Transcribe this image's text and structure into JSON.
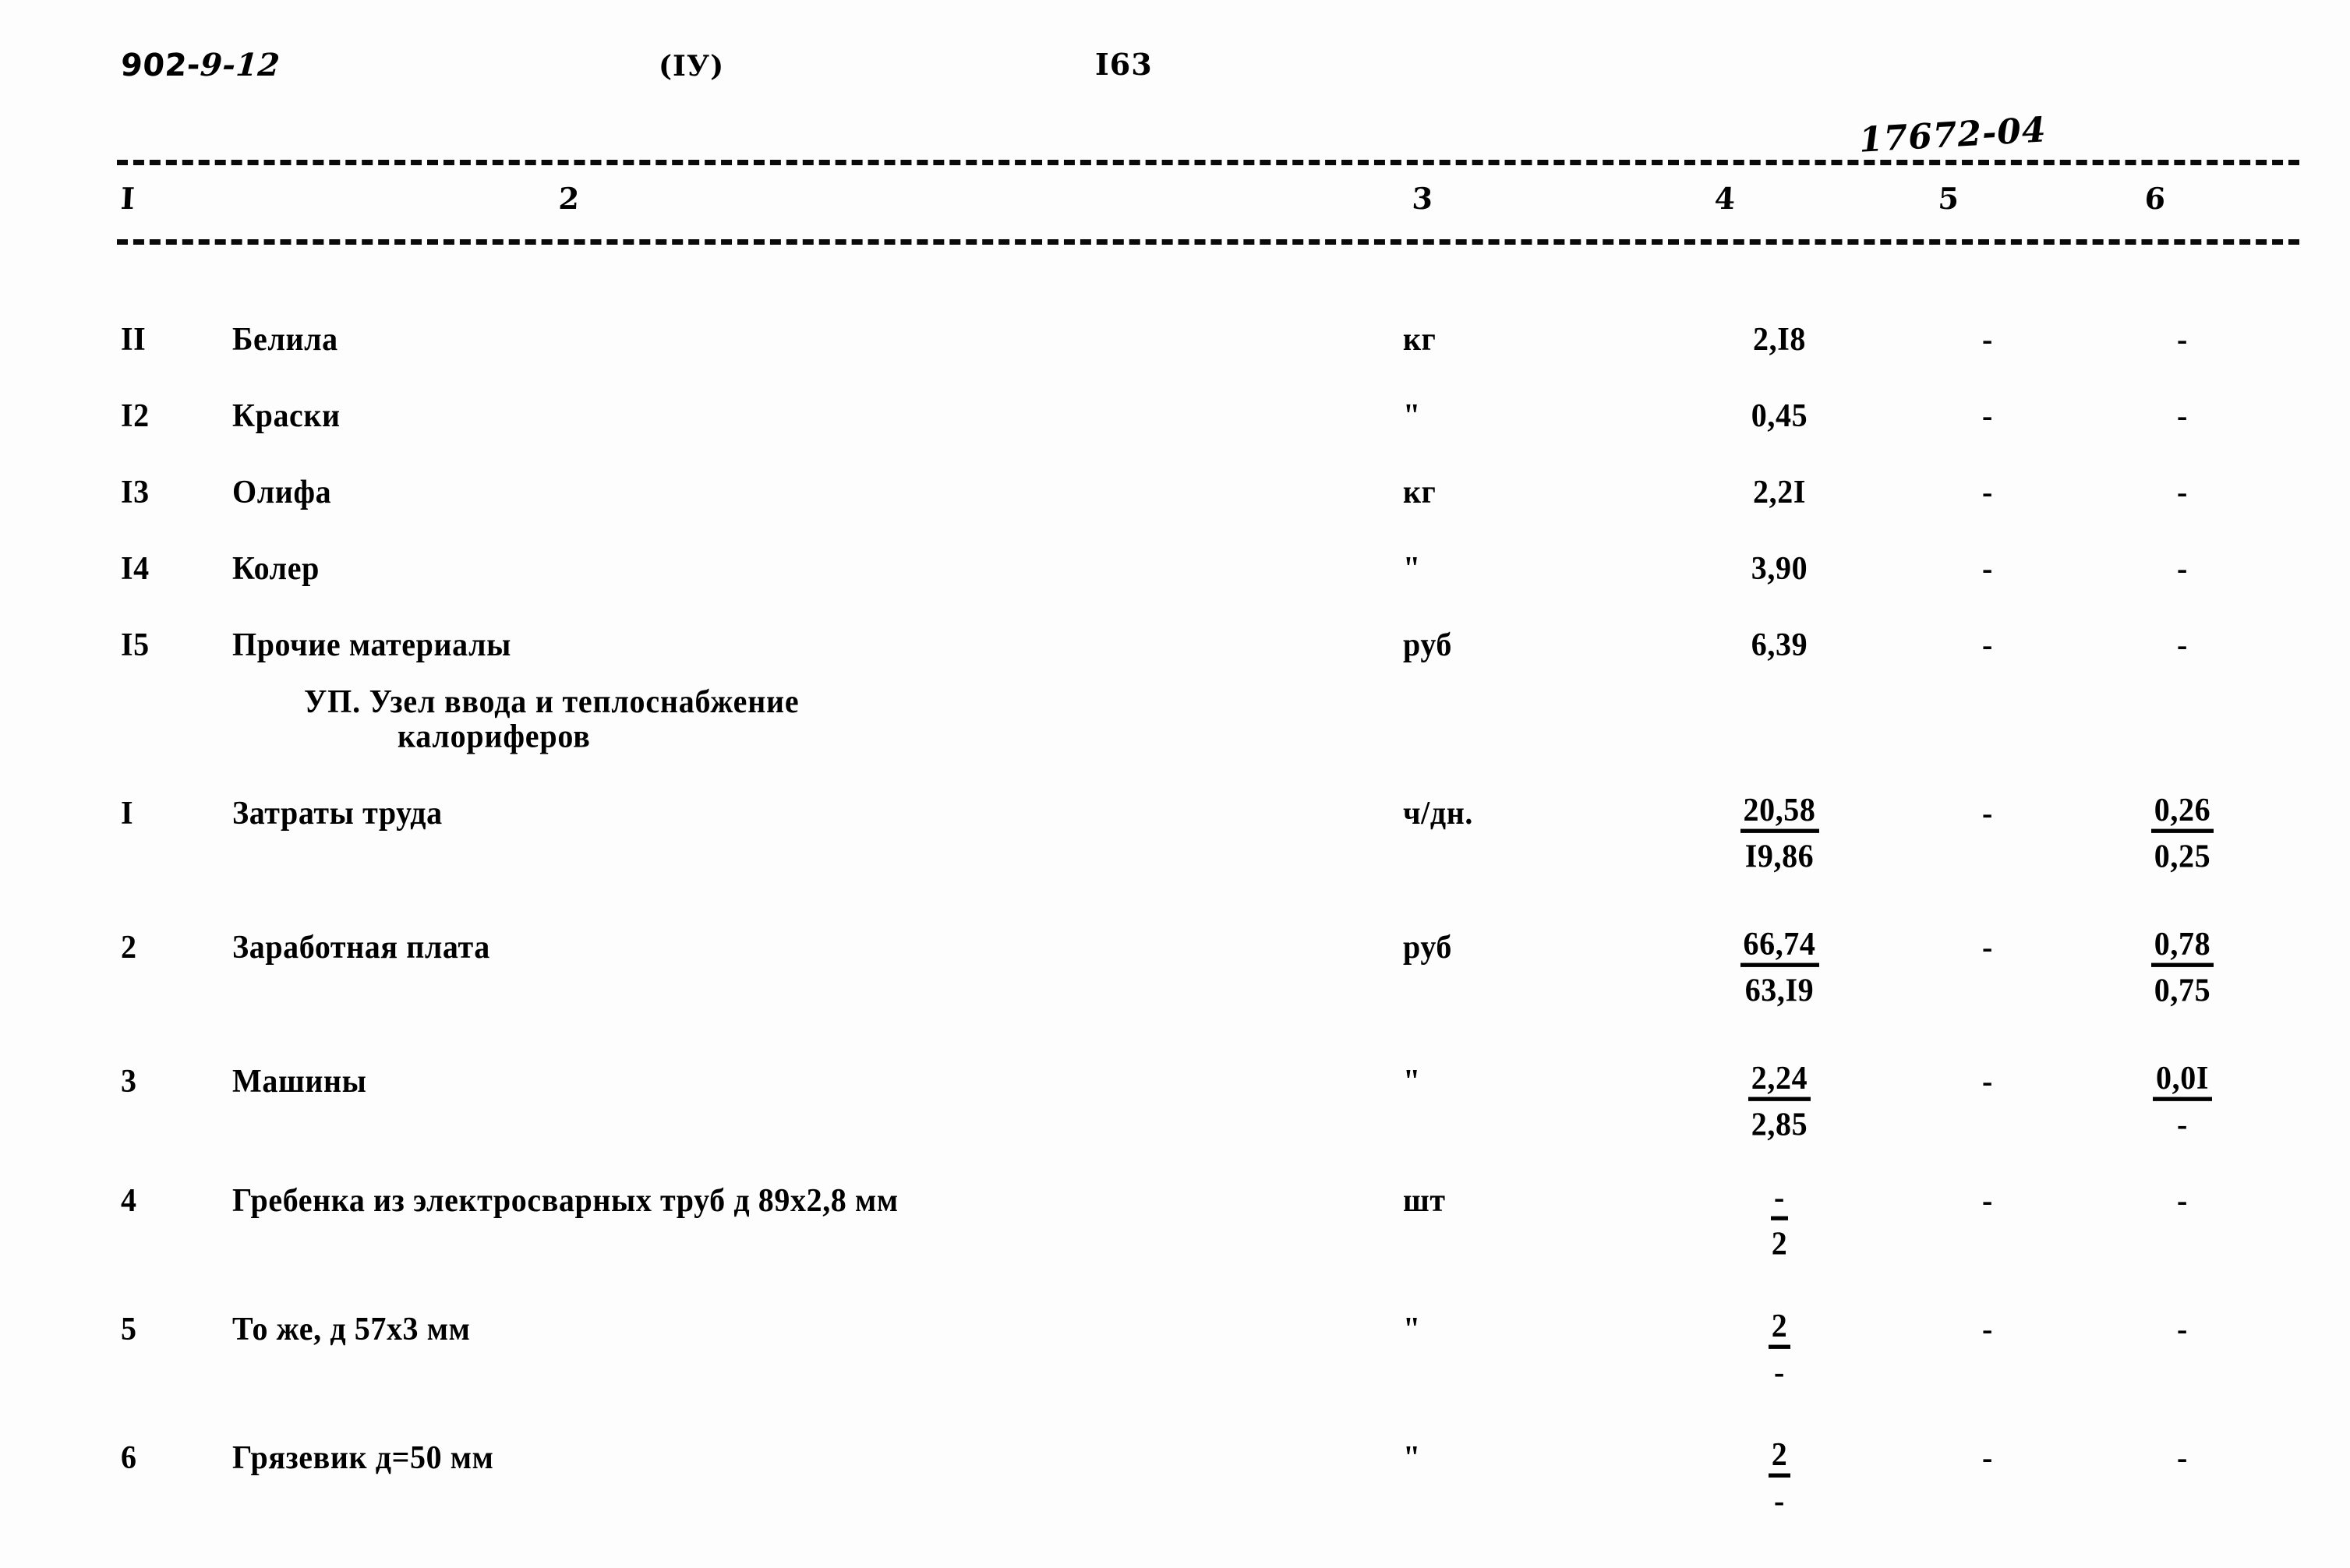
{
  "header": {
    "doc_code": "902-",
    "doc_code_hand": "9-12",
    "part": "(IУ)",
    "page_number": "I63",
    "archive_number": "17672-04"
  },
  "table": {
    "column_headers": [
      "I",
      "2",
      "3",
      "4",
      "5",
      "6"
    ],
    "rows": [
      {
        "no": "II",
        "name": "Белила",
        "unit": "кг",
        "c4": "2,I8",
        "c5": "-",
        "c6": "-"
      },
      {
        "no": "I2",
        "name": "Краски",
        "unit": "\"",
        "c4": "0,45",
        "c5": "-",
        "c6": "-"
      },
      {
        "no": "I3",
        "name": "Олифа",
        "unit": "кг",
        "c4": "2,2I",
        "c5": "-",
        "c6": "-"
      },
      {
        "no": "I4",
        "name": "Колер",
        "unit": "\"",
        "c4": "3,90",
        "c5": "-",
        "c6": "-"
      },
      {
        "no": "I5",
        "name": "Прочие материалы",
        "unit": "руб",
        "c4": "6,39",
        "c5": "-",
        "c6": "-"
      }
    ],
    "section": {
      "line1": "УП. Узел ввода и теплоснабжение",
      "line2": "калориферов"
    },
    "rows2": [
      {
        "no": "I",
        "name": "Затраты труда",
        "unit": "ч/дн.",
        "c4_num": "20,58",
        "c4_den": "I9,86",
        "c5": "-",
        "c6_num": "0,26",
        "c6_den": "0,25"
      },
      {
        "no": "2",
        "name": "Заработная плата",
        "unit": "руб",
        "c4_num": "66,74",
        "c4_den": "63,I9",
        "c5": "-",
        "c6_num": "0,78",
        "c6_den": "0,75"
      },
      {
        "no": "3",
        "name": "Машины",
        "unit": "\"",
        "c4_num": "2,24",
        "c4_den": "2,85",
        "c5": "-",
        "c6_num": "0,0I",
        "c6_den": "-"
      },
      {
        "no": "4",
        "name": "Гребенка из электросварных труб д 89x2,8 мм",
        "unit": "шт",
        "c4_num": "-",
        "c4_den": "2",
        "c5": "-",
        "c6_num": "-",
        "c6_den": ""
      },
      {
        "no": "5",
        "name": "То же, д 57x3 мм",
        "unit": "\"",
        "c4_num": "2",
        "c4_den": "-",
        "c5": "-",
        "c6_num": "-",
        "c6_den": ""
      },
      {
        "no": "6",
        "name": "Грязевик д=50 мм",
        "unit": "\"",
        "c4_num": "2",
        "c4_den": "-",
        "c5": "-",
        "c6_num": "-",
        "c6_den": ""
      }
    ]
  }
}
